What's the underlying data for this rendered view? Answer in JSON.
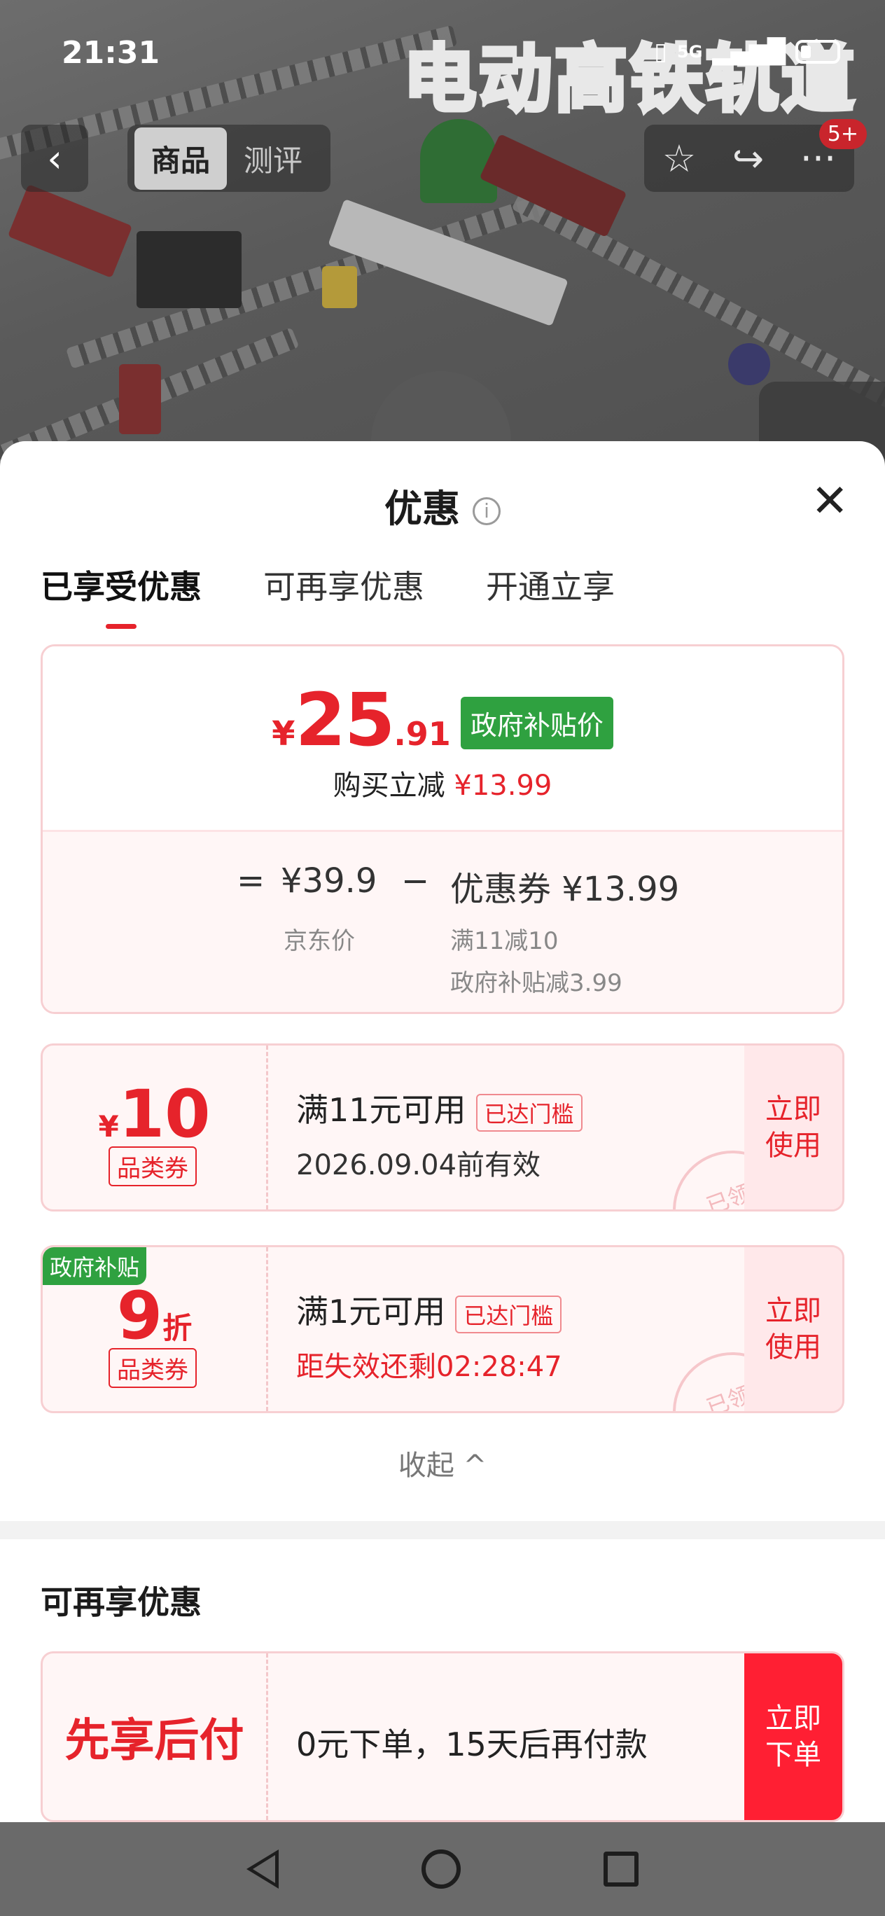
{
  "status_bar": {
    "time": "21:31",
    "network": "5G"
  },
  "hero": {
    "title": "电动高铁轨道"
  },
  "header": {
    "segments": [
      "商品",
      "测评"
    ],
    "active_segment": "商品",
    "message_badge": "5+"
  },
  "sheet": {
    "title": "优惠",
    "tabs": [
      "已享受优惠",
      "可再享优惠",
      "开通立享"
    ],
    "active_tab": "已享受优惠",
    "price": {
      "currency": "¥",
      "integer": "25",
      "decimal": ".91",
      "tag": "政府补贴价",
      "reduce_label": "购买立减",
      "reduce_amount": "¥13.99",
      "equals": "=",
      "jd_price": "¥39.9",
      "minus": "−",
      "coupon_total": "优惠券 ¥13.99",
      "jd_price_label": "京东价",
      "coupon_detail_1": "满11减10",
      "coupon_detail_2": "政府补贴减3.99"
    },
    "coupons": [
      {
        "currency": "¥",
        "amount": "10",
        "type": "品类券",
        "condition": "满11元可用",
        "threshold_tag": "已达门槛",
        "validity": "2026.09.04前有效",
        "action": "立即\n使用",
        "stamp": "已领"
      },
      {
        "corner_tag": "政府补贴",
        "amount": "9",
        "unit": "折",
        "type": "品类券",
        "condition": "满1元可用",
        "threshold_tag": "已达门槛",
        "validity": "距失效还剩02:28:47",
        "action": "立即\n使用",
        "stamp": "已领"
      }
    ],
    "collapse_label": "收起 ^",
    "section_more": "可再享优惠",
    "bnpl": {
      "title": "先享后付",
      "description": "0元下单，15天后再付款",
      "action": "立即\n下单"
    }
  },
  "colors": {
    "accent_red": "#e6232b",
    "gov_green": "#2fa140",
    "order_red": "#ff1f33"
  }
}
